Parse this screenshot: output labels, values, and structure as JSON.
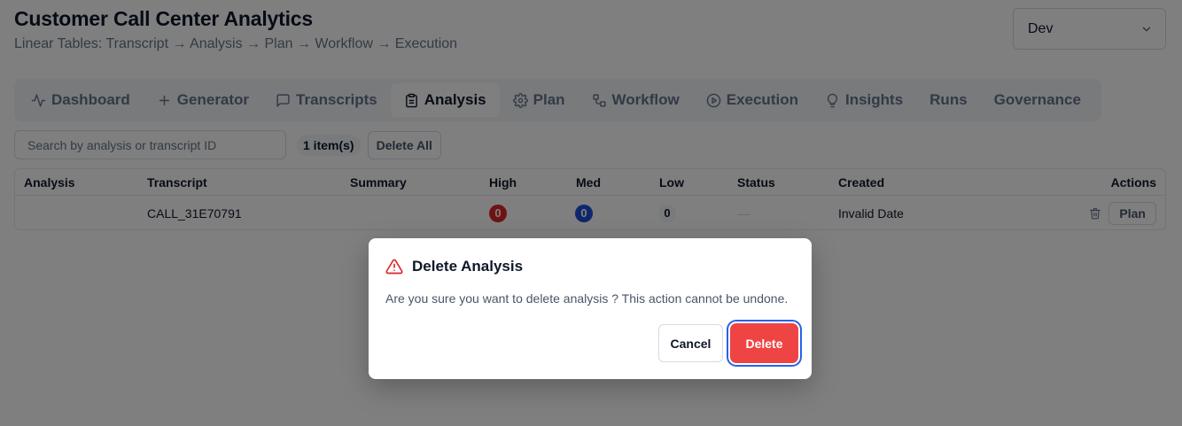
{
  "header": {
    "title": "Customer Call Center Analytics",
    "subtitle": "Linear Tables: Transcript → Analysis → Plan → Workflow → Execution"
  },
  "env_select": {
    "value": "Dev"
  },
  "tabs": [
    {
      "label": "Dashboard",
      "icon": "activity-icon"
    },
    {
      "label": "Generator",
      "icon": "plus-icon"
    },
    {
      "label": "Transcripts",
      "icon": "message-square-icon"
    },
    {
      "label": "Analysis",
      "icon": "clipboard-icon",
      "active": true
    },
    {
      "label": "Plan",
      "icon": "gear-icon"
    },
    {
      "label": "Workflow",
      "icon": "workflow-icon"
    },
    {
      "label": "Execution",
      "icon": "play-circle-icon"
    },
    {
      "label": "Insights",
      "icon": "lightbulb-icon"
    },
    {
      "label": "Runs",
      "icon": ""
    },
    {
      "label": "Governance",
      "icon": ""
    }
  ],
  "toolbar": {
    "search_placeholder": "Search by analysis or transcript ID",
    "search_value": "",
    "count": "1 item(s)",
    "delete_all_label": "Delete All"
  },
  "table": {
    "columns": [
      "Analysis",
      "Transcript",
      "Summary",
      "High",
      "Med",
      "Low",
      "Status",
      "Created",
      "Actions"
    ],
    "rows": [
      {
        "analysis": "",
        "transcript": "CALL_31E70791",
        "summary": "",
        "high": "0",
        "med": "0",
        "low": "0",
        "status": "—",
        "created": "Invalid Date",
        "action_label": "Plan"
      }
    ]
  },
  "colors": {
    "high": "#dc2626",
    "med": "#1d4ed8",
    "low_bg": "#f1f5f9",
    "danger": "#ef4444",
    "focus_ring": "#2563eb"
  },
  "modal": {
    "title": "Delete Analysis",
    "message": "Are you sure you want to delete analysis ? This action cannot be undone.",
    "cancel_label": "Cancel",
    "delete_label": "Delete"
  }
}
